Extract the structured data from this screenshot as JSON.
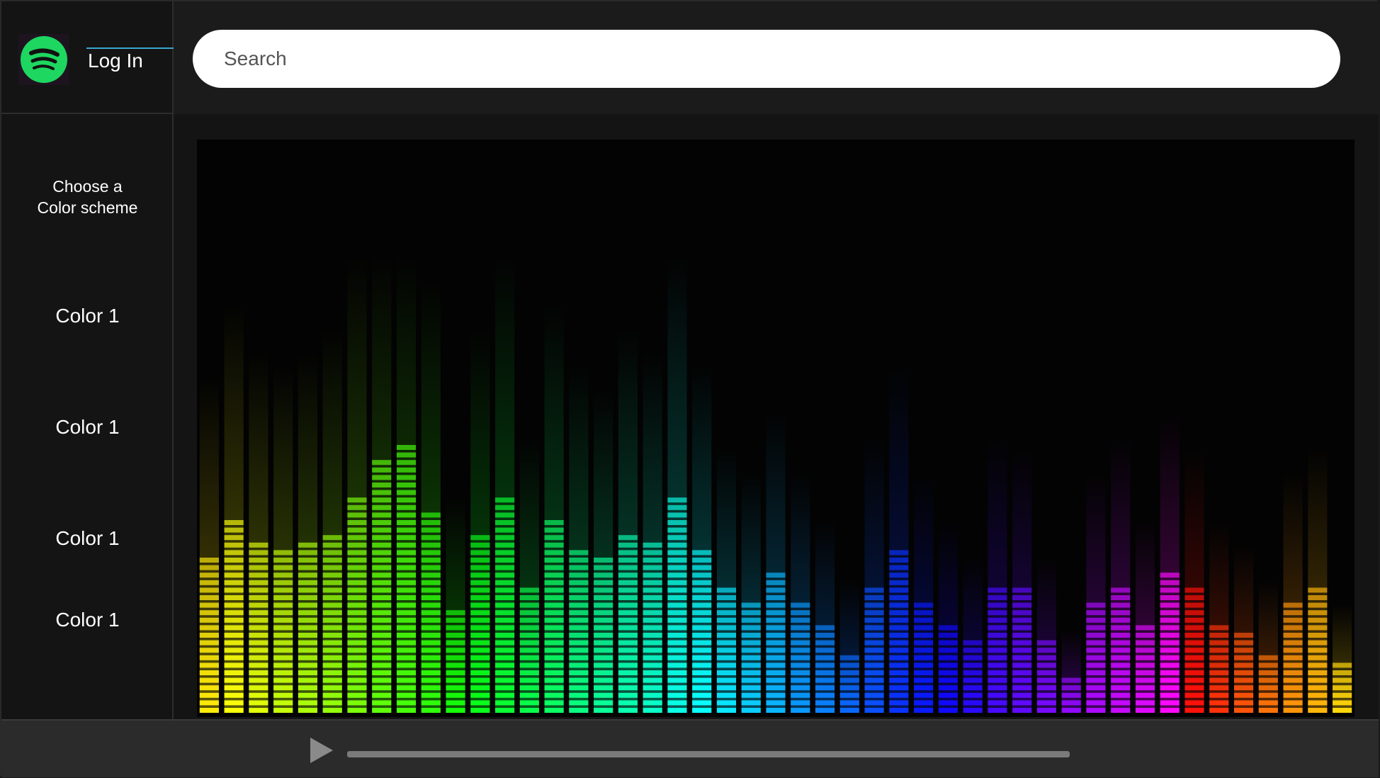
{
  "header": {
    "login_label": "Log In",
    "search_placeholder": "Search"
  },
  "sidebar": {
    "scheme_title_line1": "Choose a",
    "scheme_title_line2": "Color scheme",
    "color_options": [
      "Color 1",
      "Color 1",
      "Color 1",
      "Color 1"
    ]
  },
  "icons": {
    "logo": "spotify-logo-icon",
    "play": "play-icon"
  },
  "colors": {
    "brand_green": "#1ed760",
    "search_bg": "#ffffff",
    "accent_line": "#3aa7d0"
  },
  "equalizer": {
    "levels": [
      0.28,
      0.34,
      0.3,
      0.29,
      0.3,
      0.32,
      0.38,
      0.45,
      0.47,
      0.36,
      0.18,
      0.32,
      0.38,
      0.23,
      0.34,
      0.29,
      0.27,
      0.32,
      0.3,
      0.38,
      0.29,
      0.22,
      0.2,
      0.25,
      0.2,
      0.16,
      0.11,
      0.23,
      0.29,
      0.2,
      0.16,
      0.13,
      0.23,
      0.22,
      0.13,
      0.07,
      0.2,
      0.23,
      0.16,
      0.25,
      0.22,
      0.16,
      0.14,
      0.11,
      0.2,
      0.22,
      0.09
    ]
  }
}
